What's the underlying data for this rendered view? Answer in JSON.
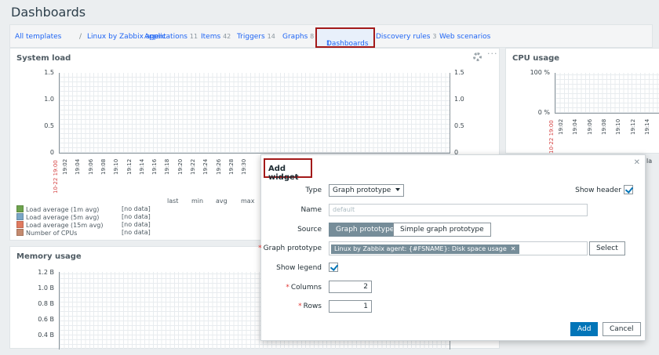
{
  "page": {
    "title": "Dashboards"
  },
  "nav": {
    "all_templates": "All templates",
    "separator": "/",
    "template": "Linux by Zabbix agent",
    "applications": "Applications",
    "applications_count": "11",
    "items": "Items",
    "items_count": "42",
    "triggers": "Triggers",
    "triggers_count": "14",
    "graphs": "Graphs",
    "graphs_count": "8",
    "dashboards": "Dashboards",
    "dashboards_count": "1",
    "discovery": "Discovery rules",
    "discovery_count": "3",
    "web": "Web scenarios"
  },
  "system_load": {
    "title": "System load",
    "y_left": [
      "1.5",
      "1.0",
      "0.5",
      "0"
    ],
    "y_right": [
      "1.5",
      "1.0",
      "0.5",
      "0"
    ],
    "x_first": "10-22 19:00",
    "x_ticks": [
      "19:02",
      "19:04",
      "19:06",
      "19:08",
      "19:10",
      "19:12",
      "19:14",
      "19:16",
      "19:18",
      "19:20",
      "19:22",
      "19:24",
      "19:26",
      "19:28",
      "19:30"
    ],
    "legend_headers": [
      "last",
      "min",
      "avg",
      "max"
    ],
    "legend": [
      {
        "label": "Load average (1m avg)",
        "value": "[no data]",
        "color": "#6da34d"
      },
      {
        "label": "Load average (5m avg)",
        "value": "[no data]",
        "color": "#79a6c6"
      },
      {
        "label": "Load average (15m avg)",
        "value": "[no data]",
        "color": "#e07a5f"
      },
      {
        "label": "Number of CPUs",
        "value": "[no data]",
        "color": "#c48a6e"
      }
    ]
  },
  "cpu_usage": {
    "title": "CPU usage",
    "y_left": [
      "100 %",
      "0 %"
    ],
    "x_first": "10-22 19:00",
    "x_ticks": [
      "19:02",
      "19:04",
      "19:06",
      "19:08",
      "19:10",
      "19:12",
      "19:14"
    ],
    "cut_label": "la"
  },
  "memory_usage": {
    "title": "Memory usage",
    "y_left": [
      "1.2 B",
      "1.0 B",
      "0.8 B",
      "0.6 B",
      "0.4 B"
    ]
  },
  "dialog": {
    "title": "Add widget",
    "type_label": "Type",
    "type_value": "Graph prototype",
    "show_header_label": "Show header",
    "name_label": "Name",
    "name_placeholder": "default",
    "source_label": "Source",
    "source_on": "Graph prototype",
    "source_off": "Simple graph prototype",
    "gp_label": "Graph prototype",
    "gp_chip": "Linux by Zabbix agent: {#FSNAME}: Disk space usage",
    "select_btn": "Select",
    "show_legend_label": "Show legend",
    "columns_label": "Columns",
    "columns_value": "2",
    "rows_label": "Rows",
    "rows_value": "1",
    "add_btn": "Add",
    "cancel_btn": "Cancel",
    "req": "*"
  }
}
